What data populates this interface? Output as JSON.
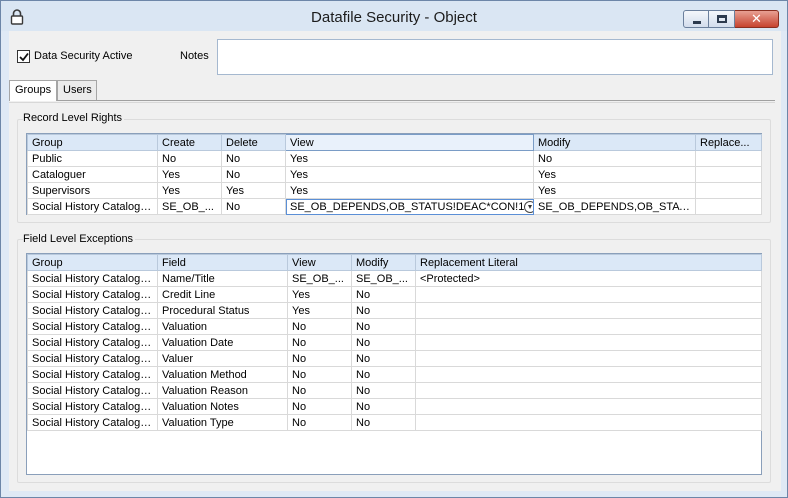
{
  "window": {
    "title": "Datafile Security - Object"
  },
  "header": {
    "data_security_label": "Data Security Active",
    "data_security_checked": true,
    "notes_label": "Notes",
    "notes_value": ""
  },
  "tabs": [
    {
      "label": "Groups",
      "active": true
    },
    {
      "label": "Users",
      "active": false
    }
  ],
  "record_level": {
    "title": "Record Level Rights",
    "columns": [
      "Group",
      "Create",
      "Delete",
      "View",
      "Modify",
      "Replace..."
    ],
    "rows": [
      [
        "Public",
        "No",
        "No",
        "Yes",
        "No",
        ""
      ],
      [
        "Cataloguer",
        "Yes",
        "No",
        "Yes",
        "Yes",
        ""
      ],
      [
        "Supervisors",
        "Yes",
        "Yes",
        "Yes",
        "Yes",
        ""
      ],
      [
        "Social History Cataloguer",
        "SE_OB_...",
        "No",
        "SE_OB_DEPENDS,OB_STATUS!DEAC*CON!1",
        "SE_OB_DEPENDS,OB_STATU...",
        ""
      ]
    ]
  },
  "field_level": {
    "title": "Field Level Exceptions",
    "columns": [
      "Group",
      "Field",
      "View",
      "Modify",
      "Replacement Literal"
    ],
    "rows": [
      [
        "Social History Cataloguer",
        "Name/Title",
        "SE_OB_...",
        "SE_OB_...",
        "<Protected>"
      ],
      [
        "Social History Cataloguer",
        "Credit Line",
        "Yes",
        "No",
        ""
      ],
      [
        "Social History Cataloguer",
        "Procedural Status",
        "Yes",
        "No",
        ""
      ],
      [
        "Social History Cataloguer",
        "Valuation",
        "No",
        "No",
        ""
      ],
      [
        "Social History Cataloguer",
        "Valuation Date",
        "No",
        "No",
        ""
      ],
      [
        "Social History Cataloguer",
        "Valuer",
        "No",
        "No",
        ""
      ],
      [
        "Social History Cataloguer",
        "Valuation Method",
        "No",
        "No",
        ""
      ],
      [
        "Social History Cataloguer",
        "Valuation Reason",
        "No",
        "No",
        ""
      ],
      [
        "Social History Cataloguer",
        "Valuation Notes",
        "No",
        "No",
        ""
      ],
      [
        "Social History Cataloguer",
        "Valuation Type",
        "No",
        "No",
        ""
      ]
    ]
  }
}
